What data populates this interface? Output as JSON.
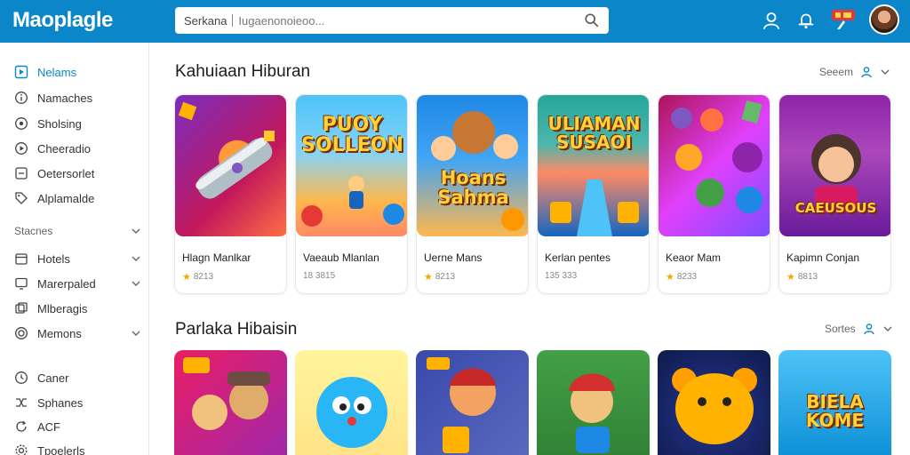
{
  "header": {
    "logo": "Maoplagle",
    "search_prefix": "Serkana",
    "search_placeholder": "Iugaenonoieoo...",
    "colors": {
      "bar": "#0a86c9"
    }
  },
  "sidebar": {
    "items_top": [
      {
        "label": "Nelams",
        "icon": "play-square-icon",
        "active": true
      },
      {
        "label": "Namaches",
        "icon": "circle-info-icon"
      },
      {
        "label": "Sholsing",
        "icon": "circle-icon"
      },
      {
        "label": "Cheeradio",
        "icon": "circle-play-icon"
      },
      {
        "label": "Oetersorlet",
        "icon": "square-icon"
      },
      {
        "label": "Alplamalde",
        "icon": "tag-icon"
      }
    ],
    "group_label": "Stacnes",
    "items_group": [
      {
        "label": "Hotels",
        "icon": "calendar-icon"
      },
      {
        "label": "Marerpaled",
        "icon": "screen-icon"
      },
      {
        "label": "Mlberagis",
        "icon": "stack-icon"
      },
      {
        "label": "Memons",
        "icon": "record-icon"
      }
    ],
    "items_bottom": [
      {
        "label": "Caner",
        "icon": "clock-icon"
      },
      {
        "label": "Sphanes",
        "icon": "shuffle-icon"
      },
      {
        "label": "ACF",
        "icon": "refresh-icon"
      },
      {
        "label": "Tpoelerls",
        "icon": "gear-icon"
      }
    ]
  },
  "sections": [
    {
      "title": "Kahuiaan Hiburan",
      "control_label": "Seeem",
      "cards": [
        {
          "title": "Hlagn Manlkar",
          "meta": "8213",
          "rated": true,
          "art": "grad-purple",
          "art_text": ""
        },
        {
          "title": "Vaeaub Mlanlan",
          "meta": "18 3815",
          "rated": false,
          "art": "grad-sky",
          "art_text": "PUOY SOLLEON"
        },
        {
          "title": "Uerne Mans",
          "meta": "8213",
          "rated": true,
          "art": "grad-blue",
          "art_text": "Hoans Sahma"
        },
        {
          "title": "Kerlan pentes",
          "meta": "135 333",
          "rated": false,
          "art": "grad-teal",
          "art_text": "ULIAMAN SUSAOI"
        },
        {
          "title": "Keaor Mam",
          "meta": "8233",
          "rated": true,
          "art": "grad-magenta",
          "art_text": ""
        },
        {
          "title": "Kapimn Conjan",
          "meta": "8813",
          "rated": true,
          "art": "grad-violet",
          "art_text": "CAEUSOUS"
        }
      ]
    },
    {
      "title": "Parlaka Hibaisin",
      "control_label": "Sortes",
      "cards": [
        {
          "art": "grad-pink"
        },
        {
          "art": "grad-yellow"
        },
        {
          "art": "grad-indigo"
        },
        {
          "art": "grad-green"
        },
        {
          "art": "grad-navy"
        },
        {
          "art": "grad-lightblue",
          "art_text": "BIELA KOME"
        }
      ]
    }
  ]
}
